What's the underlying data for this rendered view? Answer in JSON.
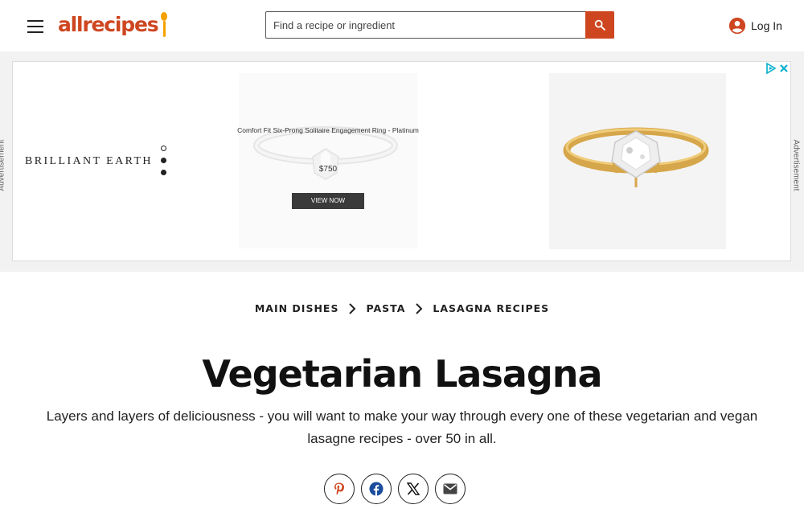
{
  "header": {
    "logo_text": "allrecipes",
    "search_placeholder": "Find a recipe or ingredient",
    "login_label": "Log In"
  },
  "ad": {
    "side_label": "Advertisement",
    "brand_text": "BRILLIANT EARTH",
    "ring_card_title": "Comfort Fit Six-Prong Solitaire Engagement Ring - Platinum",
    "ring_card_price": "$750",
    "cta_label": "VIEW NOW"
  },
  "breadcrumbs": [
    "MAIN DISHES",
    "PASTA",
    "LASAGNA RECIPES"
  ],
  "page": {
    "title": "Vegetarian Lasagna",
    "subtitle": "Layers and layers of deliciousness - you will want to make your way through every one of these vegetarian and vegan lasagne recipes - over 50 in all."
  },
  "share": {
    "icons": [
      "pinterest-icon",
      "facebook-icon",
      "x-icon",
      "email-icon"
    ]
  },
  "colors": {
    "brand": "#ce4620",
    "spoon": "#f5a100",
    "ad_background": "#f2f2f2",
    "ad_choices": "#00aecd"
  }
}
